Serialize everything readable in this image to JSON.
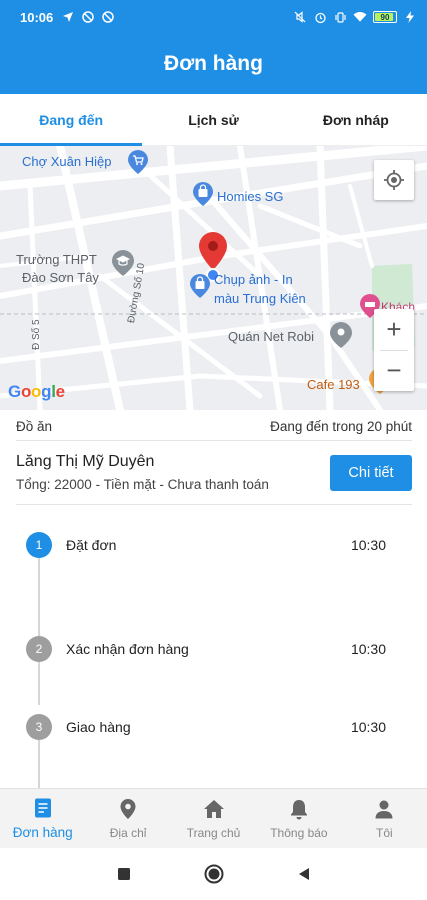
{
  "status_bar": {
    "time": "10:06",
    "battery_level": "90",
    "icons_left": [
      "navigation-icon",
      "blocked-icon",
      "blocked-icon"
    ],
    "icons_right": [
      "mute-icon",
      "alarm-icon",
      "vibrate-icon",
      "wifi-icon",
      "battery-icon",
      "charging-icon"
    ]
  },
  "app_bar": {
    "title": "Đơn hàng"
  },
  "tabs": [
    {
      "label": "Đang đến",
      "active": true
    },
    {
      "label": "Lịch sử",
      "active": false
    },
    {
      "label": "Đơn nháp",
      "active": false
    }
  ],
  "map": {
    "places": {
      "cho_xuan_hiep": "Chợ Xuân Hiệp",
      "homies": "Homies SG",
      "truong_line1": "Trường THPT",
      "truong_line2": "Đào Sơn Tây",
      "chup_anh_line1": "Chụp ảnh - In",
      "chup_anh_line2": "màu Trung Kiên",
      "quan_net": "Quán Net Robi",
      "khach": "Khách",
      "cafe": "Cafe 193",
      "duong_so_10": "Đường Số 10",
      "duong_so_5": "Đ Số 5"
    },
    "google_logo": "Google",
    "zoom_in": "+",
    "zoom_out": "−"
  },
  "order": {
    "category": "Đồ ăn",
    "status": "Đang đến trong 20 phút",
    "customer_name": "Lăng Thị Mỹ Duyên",
    "summary": "Tổng: 22000 - Tiền mặt - Chưa thanh toán",
    "detail_button": "Chi tiết"
  },
  "timeline": [
    {
      "number": "1",
      "label": "Đặt đơn",
      "time": "10:30",
      "active": true
    },
    {
      "number": "2",
      "label": "Xác nhận đơn hàng",
      "time": "10:30",
      "active": false
    },
    {
      "number": "3",
      "label": "Giao hàng",
      "time": "10:30",
      "active": false
    }
  ],
  "bottom_nav": [
    {
      "label": "Đơn hàng",
      "icon": "receipt-icon",
      "active": true
    },
    {
      "label": "Địa chỉ",
      "icon": "location-pin-icon",
      "active": false
    },
    {
      "label": "Trang chủ",
      "icon": "home-icon",
      "active": false
    },
    {
      "label": "Thông báo",
      "icon": "bell-icon",
      "active": false
    },
    {
      "label": "Tôi",
      "icon": "person-icon",
      "active": false
    }
  ],
  "colors": {
    "primary": "#1e8fe4",
    "step_active": "#1e8fe4",
    "step_inactive": "#9e9e9e",
    "map_pin": "#e53935"
  }
}
